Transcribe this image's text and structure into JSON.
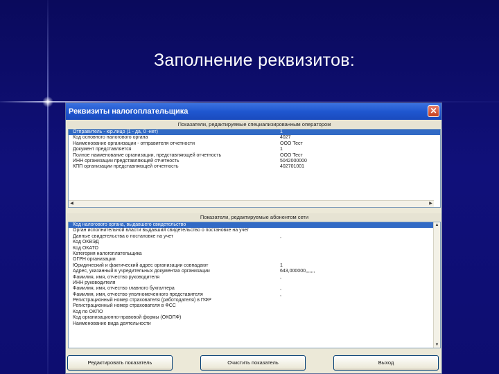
{
  "slide": {
    "title": "Заполнение реквизитов:"
  },
  "window": {
    "title": "Реквизиты налогоплательщика"
  },
  "section1": {
    "header": "Показатели, редактируемые специализированным оператором",
    "rows": [
      {
        "name": "Отправитель - юр.лицо (1 - да, 0 -нет)",
        "value": "1"
      },
      {
        "name": "Код основного налогового органа",
        "value": "4027"
      },
      {
        "name": "Наименование организации - отправителя отчетности",
        "value": "ООО Тест"
      },
      {
        "name": "Документ представляется",
        "value": "1"
      },
      {
        "name": "Полное наименование организации, представляющей отчетность",
        "value": "ООО Тест"
      },
      {
        "name": "ИНН организации представляющей отчетность",
        "value": "5042000000"
      },
      {
        "name": "КПП организации представляющей отчетность",
        "value": "402701001"
      }
    ]
  },
  "section2": {
    "header": "Показатели, редактируемые абонентом сети",
    "rows": [
      {
        "name": "Код налогового органа, выдавшего свидетельство",
        "value": ""
      },
      {
        "name": "Орган исполнительной власти выдавший свидетельство о постановке на учет",
        "value": ""
      },
      {
        "name": "Данные свидетельства о постановке на учет",
        "value": ","
      },
      {
        "name": "Код ОКВЭД",
        "value": ""
      },
      {
        "name": "Код ОКАТО",
        "value": ""
      },
      {
        "name": "Категория налогоплательщика",
        "value": ""
      },
      {
        "name": "ОГРН организации",
        "value": ""
      },
      {
        "name": "Юридический и фактический адрес организации совпадают",
        "value": "1"
      },
      {
        "name": "Адрес, указанный в учредительных документах организации",
        "value": "643,000000,,,,,,,"
      },
      {
        "name": "Фамилия, имя, отчество руководителя",
        "value": ","
      },
      {
        "name": "ИНН руководителя",
        "value": ""
      },
      {
        "name": "Фамилия, имя, отчество главного бухгалтера",
        "value": ","
      },
      {
        "name": "Фамилия, имя, отчество уполномоченного представителя",
        "value": ","
      },
      {
        "name": "Регистрационный номер страхователя (работодателя) в ПФР",
        "value": ""
      },
      {
        "name": "Регистрационный номер страхователя в ФСС",
        "value": ""
      },
      {
        "name": "Код по ОКПО",
        "value": ""
      },
      {
        "name": "Код организационно-правовой формы (ОКОПФ)",
        "value": ""
      },
      {
        "name": "Наименование вида деятельности",
        "value": ""
      }
    ]
  },
  "buttons": {
    "edit": "Редактировать показатель",
    "clear": "Очистить показатель",
    "exit": "Выход"
  },
  "colors": {
    "selection": "#316ac5",
    "slide_bg": "#0b0b6e",
    "titlebar": "#1f57d0"
  }
}
